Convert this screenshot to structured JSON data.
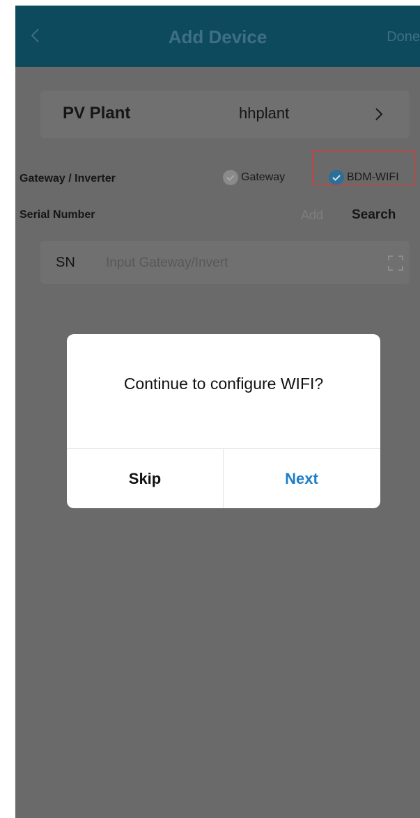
{
  "header": {
    "title": "Add Device",
    "done_label": "Done",
    "back_icon": "chevron-left-icon"
  },
  "plant": {
    "label": "PV Plant",
    "value": "hhplant",
    "chevron_icon": "chevron-right-icon"
  },
  "device_type": {
    "label": "Gateway / Inverter",
    "options": [
      {
        "label": "Gateway",
        "selected": false
      },
      {
        "label": "BDM-WIFI",
        "selected": true
      }
    ]
  },
  "serial": {
    "label": "Serial Number",
    "add_label": "Add",
    "search_label": "Search",
    "sn_label": "SN",
    "input_value": "",
    "input_placeholder": "Input Gateway/Invert",
    "scan_icon": "scan-icon"
  },
  "dialog": {
    "message": "Continue to configure WIFI?",
    "skip_label": "Skip",
    "next_label": "Next"
  },
  "colors": {
    "header_bg": "#0e4a5e",
    "overlay_bg": "#6a6a6a",
    "selected_radio": "#2c6f98",
    "unselected_radio": "#8a8a8a",
    "next_button": "#1e7ec8",
    "highlight_box": "#ff2a2a"
  }
}
